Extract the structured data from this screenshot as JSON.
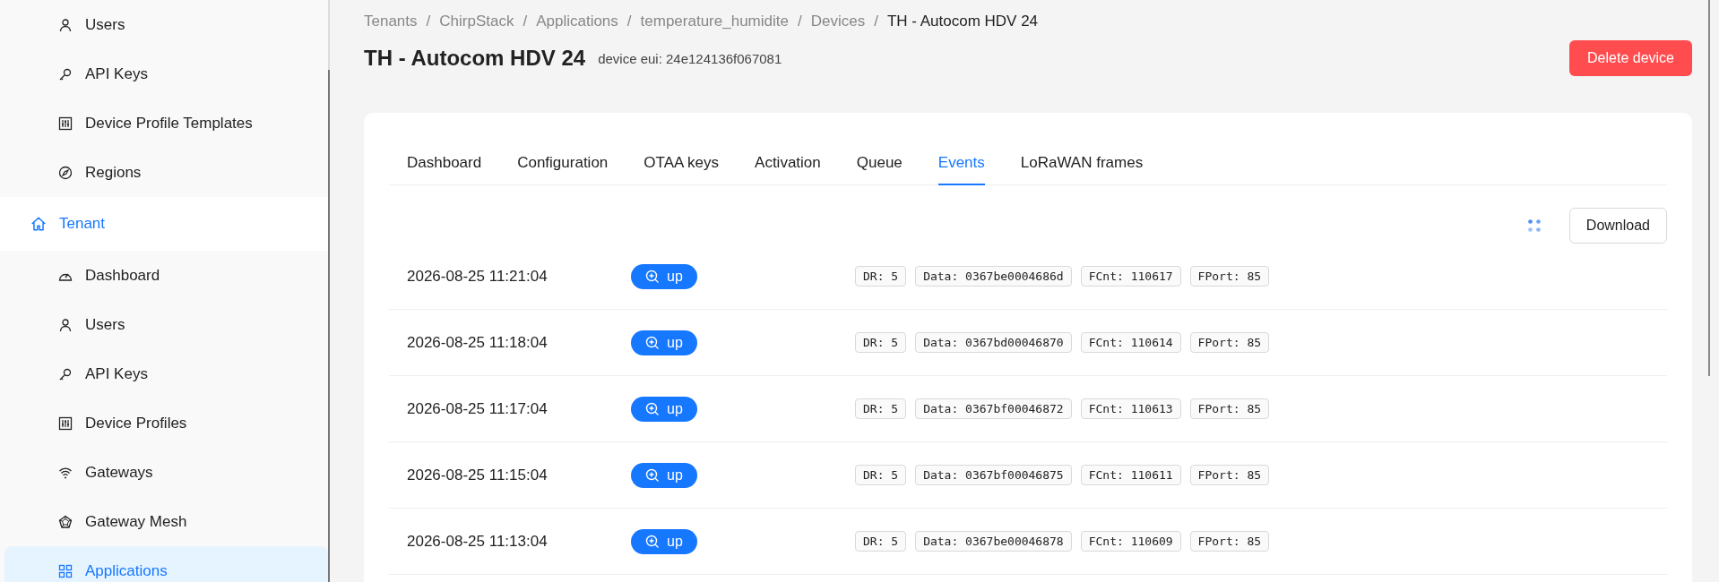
{
  "sidebar": {
    "items": [
      {
        "label": "Users",
        "selected": false
      },
      {
        "label": "API Keys",
        "selected": false
      },
      {
        "label": "Device Profile Templates",
        "selected": false
      },
      {
        "label": "Regions",
        "selected": false
      }
    ],
    "sections": [
      {
        "label": "Tenant",
        "active": true,
        "children": [
          {
            "label": "Dashboard",
            "selected": false
          },
          {
            "label": "Users",
            "selected": false
          },
          {
            "label": "API Keys",
            "selected": false
          },
          {
            "label": "Device Profiles",
            "selected": false
          },
          {
            "label": "Gateways",
            "selected": false
          },
          {
            "label": "Gateway Mesh",
            "selected": false
          },
          {
            "label": "Applications",
            "selected": true
          }
        ]
      }
    ]
  },
  "breadcrumb": [
    {
      "label": "Tenants"
    },
    {
      "separator": "/",
      "label": "ChirpStack"
    },
    {
      "separator": "/",
      "label": "Applications"
    },
    {
      "separator": "/",
      "label": "temperature_humidite"
    },
    {
      "separator": "/",
      "label": "Devices"
    },
    {
      "separator": "/",
      "label": "TH - Autocom HDV 24"
    }
  ],
  "header": {
    "title": "TH - Autocom HDV 24",
    "subtitle": "device eui: 24e124136f067081",
    "delete_button": "Delete device"
  },
  "tabs": [
    {
      "label": "Dashboard",
      "selected": false
    },
    {
      "label": "Configuration",
      "selected": false
    },
    {
      "label": "OTAA keys",
      "selected": false
    },
    {
      "label": "Activation",
      "selected": false
    },
    {
      "label": "Queue",
      "selected": false
    },
    {
      "label": "Events",
      "selected": true
    },
    {
      "label": "LoRaWAN frames",
      "selected": false
    }
  ],
  "toolbar": {
    "download_button": "Download"
  },
  "events": [
    {
      "time": "2026-08-25 11:21:04",
      "type": "up",
      "tags": [
        "DR: 5",
        "Data: 0367be0004686d",
        "FCnt: 110617",
        "FPort: 85"
      ]
    },
    {
      "time": "2026-08-25 11:18:04",
      "type": "up",
      "tags": [
        "DR: 5",
        "Data: 0367bd00046870",
        "FCnt: 110614",
        "FPort: 85"
      ]
    },
    {
      "time": "2026-08-25 11:17:04",
      "type": "up",
      "tags": [
        "DR: 5",
        "Data: 0367bf00046872",
        "FCnt: 110613",
        "FPort: 85"
      ]
    },
    {
      "time": "2026-08-25 11:15:04",
      "type": "up",
      "tags": [
        "DR: 5",
        "Data: 0367bf00046875",
        "FCnt: 110611",
        "FPort: 85"
      ]
    },
    {
      "time": "2026-08-25 11:13:04",
      "type": "up",
      "tags": [
        "DR: 5",
        "Data: 0367be00046878",
        "FCnt: 110609",
        "FPort: 85"
      ]
    }
  ]
}
